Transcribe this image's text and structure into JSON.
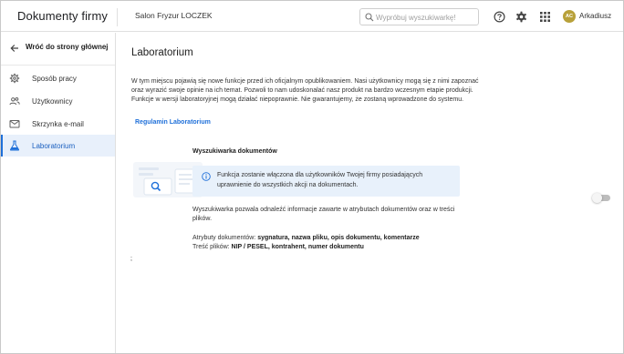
{
  "header": {
    "app_title": "Dokumenty firmy",
    "company": "Salon Fryzur LOCZEK",
    "search_placeholder": "Wypróbuj wyszukiwarkę!",
    "help_icon": "help-circle-icon",
    "settings_icon": "gear-icon",
    "apps_icon": "apps-grid-icon",
    "avatar_initials": "AC",
    "avatar_color": "#b8a13a",
    "user_name": "Arkadiusz"
  },
  "sidebar": {
    "back_label": "Wróć do strony głównej",
    "items": [
      {
        "label": "Sposób pracy",
        "icon": "gear-icon",
        "active": false
      },
      {
        "label": "Użytkownicy",
        "icon": "users-icon",
        "active": false
      },
      {
        "label": "Skrzynka e-mail",
        "icon": "mail-icon",
        "active": false
      },
      {
        "label": "Laboratorium",
        "icon": "flask-icon",
        "active": true
      }
    ]
  },
  "main": {
    "title": "Laboratorium",
    "intro": "W tym miejscu pojawią się nowe funkcje przed ich oficjalnym opublikowaniem. Nasi użytkownicy mogą się z nimi zapoznać oraz wyrazić swoje opinie na ich temat. Pozwoli to nam udoskonalać nasz produkt na bardzo wczesnym etapie produkcji. Funkcje w wersji laboratoryjnej mogą działać niepoprawnie. Nie gwarantujemy, że zostaną wprowadzone do systemu.",
    "rules_link": "Regulamin Laboratorium",
    "feature": {
      "title": "Wyszukiwarka dokumentów",
      "info": "Funkcja zostanie włączona dla użytkowników Twojej firmy posiadających uprawnienie do wszystkich akcji na dokumentach.",
      "enabled": false,
      "description": "Wyszukiwarka pozwala odnaleźć informacje zawarte w atrybutach dokumentów oraz w treści plików.",
      "attrs_label": "Atrybuty dokumentów:",
      "attrs_value": "sygnatura, nazwa pliku, opis dokumentu, komentarze",
      "content_label": "Treść plików:",
      "content_value": "NIP / PESEL, kontrahent, numer dokumentu"
    },
    "stray": ";"
  },
  "colors": {
    "accent": "#1e6fd9",
    "active_bg": "#e8f0fb",
    "info_bg": "#e8f1fb"
  }
}
